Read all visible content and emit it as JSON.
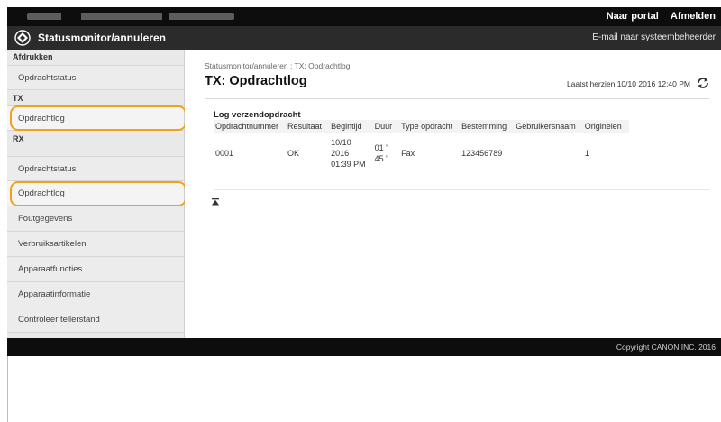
{
  "topbar": {
    "portal_link": "Naar portal",
    "logout_link": "Afmelden"
  },
  "titlebar": {
    "title": "Statusmonitor/annuleren",
    "mail_link": "E-mail naar systeembeheerder"
  },
  "sidebar": {
    "sections": [
      {
        "heading": "Afdrukken",
        "items": [
          "Opdrachtstatus"
        ]
      },
      {
        "heading": "TX",
        "items": [
          "Opdrachtlog"
        ]
      },
      {
        "heading": "RX",
        "items": [
          "Opdrachtstatus",
          "Opdrachtlog"
        ]
      },
      {
        "heading": "",
        "items": [
          "Foutgegevens",
          "Verbruiksartikelen",
          "Apparaatfuncties",
          "Apparaatinformatie",
          "Controleer tellerstand"
        ]
      }
    ]
  },
  "main": {
    "breadcrumb": [
      "Statusmonitor/annuleren",
      "TX: Opdrachtlog"
    ],
    "breadcrumb_separator": " : ",
    "title": "TX: Opdrachtlog",
    "last_updated": "Laatst herzien:10/10 2016 12:40 PM",
    "panel_title": "Log verzendopdracht",
    "table": {
      "columns": [
        "Opdrachtnummer",
        "Resultaat",
        "Begintijd",
        "Duur",
        "Type opdracht",
        "Bestemming",
        "Gebruikersnaam",
        "Originelen"
      ],
      "rows": [
        {
          "job_number": "0001",
          "result": "OK",
          "start_time_lines": [
            "10/10",
            "2016",
            "01:39 PM"
          ],
          "duration_lines": [
            "01 '",
            "45 \""
          ],
          "job_type": "Fax",
          "destination": "123456789",
          "user_name": "",
          "originals": "1"
        }
      ]
    }
  },
  "footer": {
    "copyright": "Copyright CANON INC. 2016"
  },
  "colors": {
    "highlight": "#f0a21a",
    "topbar": "#0d0d0d",
    "titlebar": "#2b2b2b",
    "sidebar": "#e9e9e9"
  },
  "icons": {
    "logo": "canon-diamond-logo-icon",
    "refresh": "refresh-icon",
    "back_to_top": "back-to-top-icon"
  }
}
